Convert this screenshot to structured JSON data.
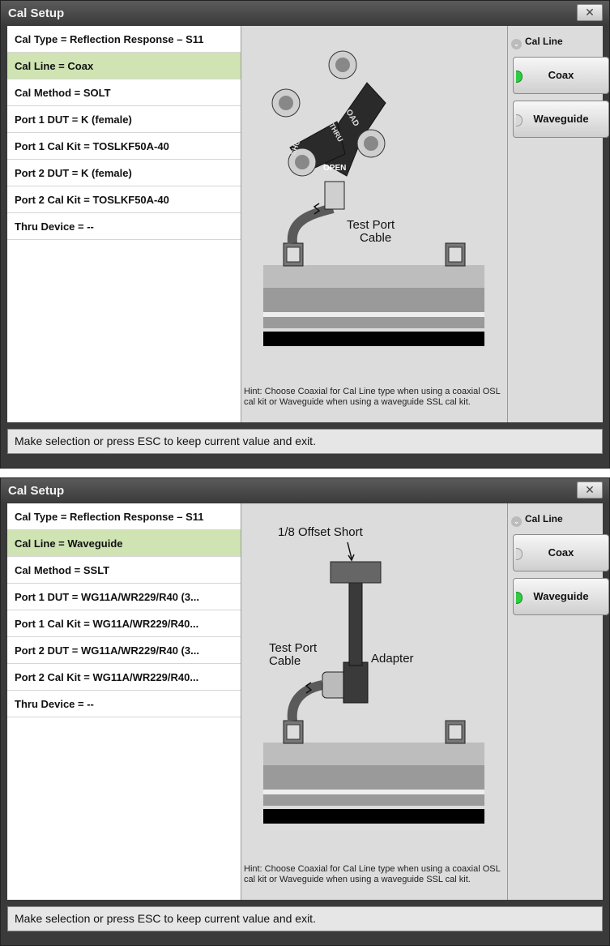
{
  "dialogs": [
    {
      "title": "Cal Setup",
      "close_label": "✕",
      "settings": [
        "Cal Type = Reflection Response – S11",
        "Cal Line = Coax",
        "Cal Method = SOLT",
        "Port 1 DUT = K (female)",
        "Port 1 Cal Kit = TOSLKF50A-40",
        "Port 2 DUT = K (female)",
        "Port 2 Cal Kit = TOSLKF50A-40",
        "Thru Device = --"
      ],
      "selected_index": 1,
      "diagram_labels": {
        "load": "LOAD",
        "thru": "THRU",
        "short": "SHORT",
        "open": "OPEN",
        "test_port_1": "Test Port",
        "test_port_2": "Cable"
      },
      "hint": "Hint: Choose Coaxial for Cal Line type when using a coaxial OSL cal kit or Waveguide when using a waveguide SSL cal kit.",
      "cal_line_label": "Cal Line",
      "options": [
        {
          "label": "Coax",
          "active": true
        },
        {
          "label": "Waveguide",
          "active": false
        }
      ],
      "status": "Make selection or press ESC to keep current value and exit."
    },
    {
      "title": "Cal Setup",
      "close_label": "✕",
      "settings": [
        "Cal Type = Reflection Response – S11",
        "Cal Line = Waveguide",
        "Cal Method = SSLT",
        "Port 1 DUT = WG11A/WR229/R40 (3...",
        "Port 1 Cal Kit = WG11A/WR229/R40...",
        "Port 2 DUT = WG11A/WR229/R40 (3...",
        "Port 2 Cal Kit = WG11A/WR229/R40...",
        "Thru Device = --"
      ],
      "selected_index": 1,
      "diagram_labels": {
        "offset_short": "1/8 Offset Short",
        "adapter": "Adapter",
        "test_port_1": "Test Port",
        "test_port_2": "Cable"
      },
      "hint": "Hint: Choose Coaxial for Cal Line type when using a coaxial OSL cal kit or Waveguide when using a waveguide SSL cal kit.",
      "cal_line_label": "Cal Line",
      "options": [
        {
          "label": "Coax",
          "active": false
        },
        {
          "label": "Waveguide",
          "active": true
        }
      ],
      "status": "Make selection or press ESC to keep current value and exit."
    }
  ]
}
